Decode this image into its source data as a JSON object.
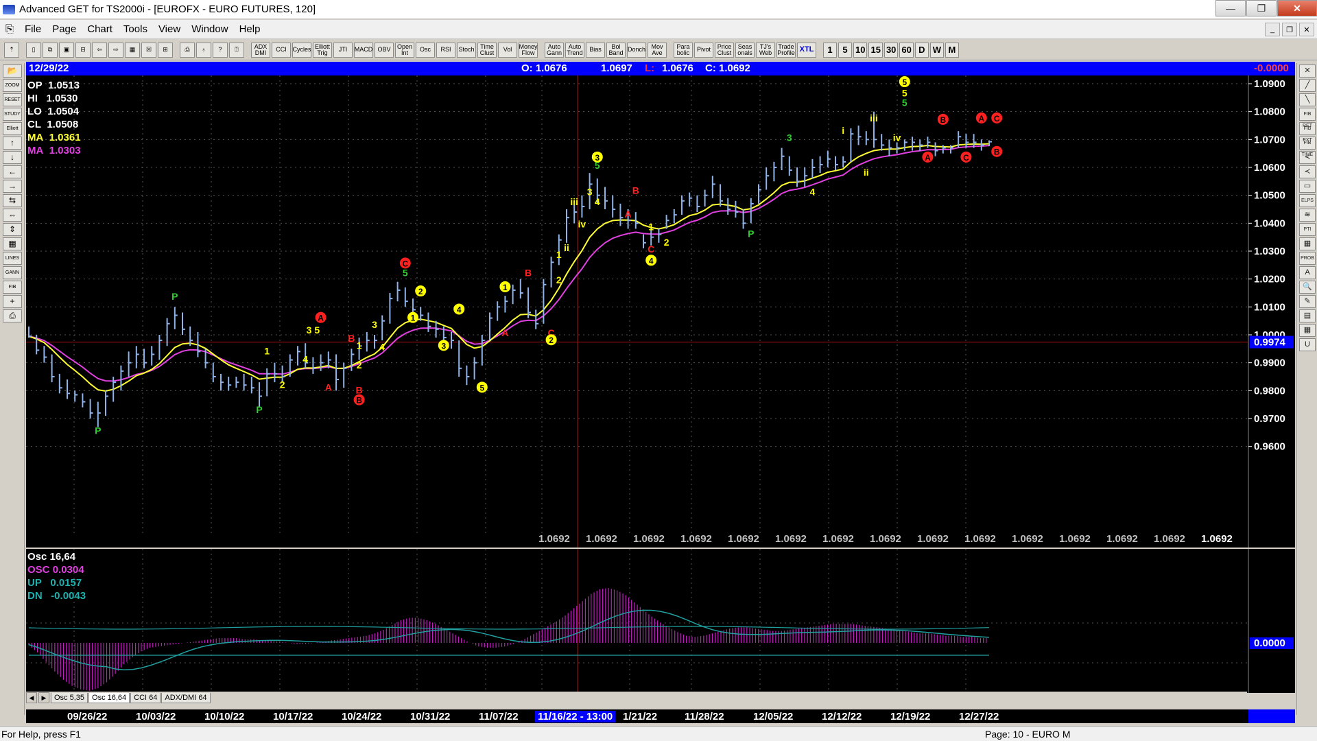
{
  "window": {
    "title": "Advanced GET for TS2000i - [EUROFX - EURO FUTURES, 120]",
    "minimize": "—",
    "restore": "❐",
    "close": "✕"
  },
  "menu": [
    "File",
    "Page",
    "Chart",
    "Tools",
    "View",
    "Window",
    "Help"
  ],
  "mdi_buttons": [
    "_",
    "❐",
    "✕"
  ],
  "toolbar": {
    "studies": [
      "ADX DMI",
      "CCI",
      "Cycles",
      "Elliott Trig",
      "JTI",
      "MACD",
      "OBV",
      "Open Int",
      "Osc",
      "RSI",
      "Stoch",
      "Time Clust",
      "Vol",
      "Money Flow",
      "Auto Gann",
      "Auto Trend",
      "Bias",
      "Bol Band",
      "Donch",
      "Mov Ave",
      "Para bolic",
      "Pivot",
      "Price Clust",
      "Seas onals",
      "TJ's Web",
      "Trade Profile",
      "XTL"
    ],
    "timeframes": [
      "1",
      "5",
      "10",
      "15",
      "30",
      "60",
      "D",
      "W",
      "M"
    ]
  },
  "left_tools": [
    "📂",
    "ZOOM",
    "RESET",
    "STUDY",
    "Elliott",
    "↑",
    "↓",
    "←",
    "→",
    "⇆",
    "⇔",
    "⇕",
    "▦",
    "LINES",
    "GANN",
    "FIB",
    "+",
    "⎙"
  ],
  "right_tools": [
    "✕",
    "╱",
    "╲",
    "FIB RET",
    "FIB EXT",
    "FIB TIME",
    "≺",
    "≺",
    "▭",
    "ELPS",
    "≋",
    "PTI",
    "▦",
    "PROB",
    "A",
    "🔍",
    "✎",
    "▤",
    "▦",
    "U"
  ],
  "price_header": {
    "date": "12/29/22",
    "open": "O: 1.0676",
    "high": "1.0697",
    "low_label": "L:",
    "low": "1.0676",
    "close": "C: 1.0692",
    "change": "-0.0000"
  },
  "stats": {
    "op_label": "OP",
    "op": "1.0513",
    "hi_label": "HI",
    "hi": "1.0530",
    "lo_label": "LO",
    "lo": "1.0504",
    "cl_label": "CL",
    "cl": "1.0508",
    "ma1_label": "MA",
    "ma1": "1.0361",
    "ma2_label": "MA",
    "ma2": "1.0303"
  },
  "osc_stats": {
    "title": "Osc 16,64",
    "osc_label": "OSC",
    "osc": "0.0304",
    "up_label": "UP",
    "up": "0.0157",
    "dn_label": "DN",
    "dn": "-0.0043",
    "zero_label": "0.0000"
  },
  "price_axis": [
    "1.0900",
    "1.0800",
    "1.0700",
    "1.0600",
    "1.0500",
    "1.0400",
    "1.0300",
    "1.0200",
    "1.0100",
    "1.0000",
    "0.9900",
    "0.9800",
    "0.9700",
    "0.9600"
  ],
  "current_price_label": "0.9974",
  "projection_labels": [
    "1.0692",
    "1.0692",
    "1.0692",
    "1.0692",
    "1.0692",
    "1.0692",
    "1.0692",
    "1.0692",
    "1.0692",
    "1.0692",
    "1.0692",
    "1.0692",
    "1.0692",
    "1.0692",
    "1.0692"
  ],
  "dates": [
    "09/26/22",
    "10/03/22",
    "10/10/22",
    "10/17/22",
    "10/24/22",
    "10/31/22",
    "11/07/22",
    "11/16/22 - 13:00",
    "1/21/22",
    "11/28/22",
    "12/05/22",
    "12/12/22",
    "12/19/22",
    "12/27/22"
  ],
  "selected_date_index": 7,
  "tabs": [
    "Osc 5,35",
    "Osc 16,64",
    "CCI 64",
    "ADX/DMI 64"
  ],
  "active_tab": 1,
  "tab_arrows": [
    "◀",
    "▶"
  ],
  "status": {
    "help": "For Help, press F1",
    "page": "Page: 10 - EURO M"
  },
  "colors": {
    "price_bar": "#8fb2e8",
    "ma_fast": "#ffff33",
    "ma_slow": "#e040e0",
    "header_blue": "#0000ff",
    "wave_yellow": "#ffff00",
    "wave_red": "#ff2020",
    "wave_green": "#33cc33",
    "osc_hist": "#c020c0",
    "osc_band": "#20a0a0"
  },
  "chart_data": {
    "type": "bar",
    "series_name": "",
    "ylim": [
      0.955,
      1.092
    ],
    "bars": [
      [
        1.003,
        0.999,
        0.9995
      ],
      [
        1.0,
        0.993,
        0.9945
      ],
      [
        0.996,
        0.99,
        0.992
      ],
      [
        0.993,
        0.983,
        0.985
      ],
      [
        0.986,
        0.979,
        0.981
      ],
      [
        0.984,
        0.977,
        0.979
      ],
      [
        0.98,
        0.976,
        0.9785
      ],
      [
        0.979,
        0.974,
        0.976
      ],
      [
        0.977,
        0.97,
        0.972
      ],
      [
        0.976,
        0.967,
        0.972
      ],
      [
        0.98,
        0.971,
        0.978
      ],
      [
        0.985,
        0.976,
        0.983
      ],
      [
        0.989,
        0.98,
        0.987
      ],
      [
        0.994,
        0.985,
        0.99
      ],
      [
        0.996,
        0.988,
        0.993
      ],
      [
        0.995,
        0.988,
        0.99
      ],
      [
        0.996,
        0.989,
        0.993
      ],
      [
        1.0,
        0.991,
        0.998
      ],
      [
        1.006,
        0.996,
        1.004
      ],
      [
        1.01,
        1.002,
        1.007
      ],
      [
        1.008,
        1.0,
        1.002
      ],
      [
        1.003,
        0.996,
        0.998
      ],
      [
        1.001,
        0.992,
        0.994
      ],
      [
        0.995,
        0.988,
        0.99
      ],
      [
        0.99,
        0.983,
        0.985
      ],
      [
        0.986,
        0.98,
        0.983
      ],
      [
        0.985,
        0.98,
        0.982
      ],
      [
        0.985,
        0.981,
        0.983
      ],
      [
        0.986,
        0.98,
        0.982
      ],
      [
        0.985,
        0.979,
        0.981
      ],
      [
        0.983,
        0.974,
        0.978
      ],
      [
        0.988,
        0.978,
        0.986
      ],
      [
        0.99,
        0.983,
        0.986
      ],
      [
        0.989,
        0.983,
        0.985
      ],
      [
        0.993,
        0.985,
        0.991
      ],
      [
        0.996,
        0.989,
        0.994
      ],
      [
        0.997,
        0.988,
        0.99
      ],
      [
        0.992,
        0.986,
        0.988
      ],
      [
        0.993,
        0.987,
        0.99
      ],
      [
        0.994,
        0.988,
        0.991
      ],
      [
        0.993,
        0.98,
        0.984
      ],
      [
        0.99,
        0.981,
        0.988
      ],
      [
        0.995,
        0.987,
        0.993
      ],
      [
        0.999,
        0.991,
        0.996
      ],
      [
        1.001,
        0.994,
        0.998
      ],
      [
        1.0,
        0.995,
        0.998
      ],
      [
        1.007,
        0.998,
        1.005
      ],
      [
        1.015,
        1.004,
        1.013
      ],
      [
        1.019,
        1.012,
        1.016
      ],
      [
        1.017,
        1.01,
        1.012
      ],
      [
        1.013,
        1.006,
        1.009
      ],
      [
        1.01,
        1.005,
        1.007
      ],
      [
        1.008,
        1.001,
        1.003
      ],
      [
        1.005,
        0.999,
        1.002
      ],
      [
        1.003,
        0.996,
        0.999
      ],
      [
        1.001,
        0.995,
        0.998
      ],
      [
        0.998,
        0.985,
        0.988
      ],
      [
        0.989,
        0.982,
        0.985
      ],
      [
        0.992,
        0.984,
        0.99
      ],
      [
        1.0,
        0.989,
        0.998
      ],
      [
        1.008,
        0.998,
        1.006
      ],
      [
        1.012,
        1.005,
        1.01
      ],
      [
        1.014,
        1.008,
        1.012
      ],
      [
        1.018,
        1.011,
        1.016
      ],
      [
        1.02,
        1.013,
        1.015
      ],
      [
        1.017,
        1.006,
        1.008
      ],
      [
        1.009,
        1.002,
        1.004
      ],
      [
        1.02,
        1.004,
        1.018
      ],
      [
        1.028,
        1.017,
        1.026
      ],
      [
        1.036,
        1.025,
        1.034
      ],
      [
        1.045,
        1.033,
        1.042
      ],
      [
        1.048,
        1.04,
        1.044
      ],
      [
        1.05,
        1.042,
        1.046
      ],
      [
        1.058,
        1.045,
        1.054
      ],
      [
        1.056,
        1.047,
        1.05
      ],
      [
        1.053,
        1.045,
        1.048
      ],
      [
        1.05,
        1.042,
        1.045
      ],
      [
        1.047,
        1.039,
        1.042
      ],
      [
        1.045,
        1.038,
        1.041
      ],
      [
        1.044,
        1.038,
        1.04
      ],
      [
        1.036,
        1.031,
        1.033
      ],
      [
        1.038,
        1.032,
        1.035
      ],
      [
        1.038,
        1.033,
        1.036
      ],
      [
        1.043,
        1.038,
        1.041
      ],
      [
        1.045,
        1.04,
        1.043
      ],
      [
        1.05,
        1.043,
        1.048
      ],
      [
        1.051,
        1.046,
        1.049
      ],
      [
        1.05,
        1.044,
        1.046
      ],
      [
        1.052,
        1.046,
        1.05
      ],
      [
        1.057,
        1.049,
        1.054
      ],
      [
        1.054,
        1.046,
        1.048
      ],
      [
        1.049,
        1.043,
        1.045
      ],
      [
        1.048,
        1.042,
        1.044
      ],
      [
        1.045,
        1.038,
        1.04
      ],
      [
        1.049,
        1.04,
        1.047
      ],
      [
        1.054,
        1.047,
        1.052
      ],
      [
        1.06,
        1.052,
        1.057
      ],
      [
        1.062,
        1.055,
        1.06
      ],
      [
        1.067,
        1.059,
        1.064
      ],
      [
        1.064,
        1.057,
        1.059
      ],
      [
        1.06,
        1.053,
        1.055
      ],
      [
        1.06,
        1.053,
        1.057
      ],
      [
        1.063,
        1.056,
        1.06
      ],
      [
        1.064,
        1.058,
        1.061
      ],
      [
        1.066,
        1.06,
        1.063
      ],
      [
        1.064,
        1.059,
        1.061
      ],
      [
        1.064,
        1.06,
        1.062
      ],
      [
        1.074,
        1.062,
        1.072
      ],
      [
        1.075,
        1.068,
        1.071
      ],
      [
        1.073,
        1.068,
        1.07
      ],
      [
        1.08,
        1.067,
        1.07
      ],
      [
        1.072,
        1.066,
        1.068
      ],
      [
        1.07,
        1.064,
        1.067
      ],
      [
        1.069,
        1.065,
        1.067
      ],
      [
        1.07,
        1.066,
        1.069
      ],
      [
        1.071,
        1.066,
        1.069
      ],
      [
        1.07,
        1.066,
        1.068
      ],
      [
        1.071,
        1.067,
        1.069
      ],
      [
        1.069,
        1.064,
        1.066
      ],
      [
        1.068,
        1.065,
        1.067
      ],
      [
        1.068,
        1.065,
        1.067
      ],
      [
        1.073,
        1.067,
        1.071
      ],
      [
        1.072,
        1.067,
        1.069
      ],
      [
        1.072,
        1.067,
        1.069
      ],
      [
        1.07,
        1.066,
        1.068
      ],
      [
        1.0697,
        1.0676,
        1.0692
      ]
    ],
    "osc_ylim": [
      -0.05,
      0.05
    ],
    "osc_values": [
      -0.002,
      -0.008,
      -0.016,
      -0.024,
      -0.031,
      -0.036,
      -0.039,
      -0.04,
      -0.038,
      -0.033,
      -0.026,
      -0.018,
      -0.012,
      -0.007,
      -0.004,
      -0.003,
      -0.002,
      -0.001,
      0.0,
      0.001,
      0.002,
      0.003,
      0.004,
      0.004,
      0.004,
      0.003,
      0.003,
      0.002,
      0.002,
      0.001,
      0.0,
      -0.001,
      -0.001,
      0.0,
      0.001,
      0.002,
      0.003,
      0.004,
      0.005,
      0.006,
      0.008,
      0.011,
      0.015,
      0.019,
      0.021,
      0.021,
      0.019,
      0.016,
      0.012,
      0.008,
      0.004,
      0.0,
      -0.003,
      -0.004,
      -0.004,
      -0.003,
      -0.001,
      0.002,
      0.006,
      0.01,
      0.014,
      0.018,
      0.023,
      0.029,
      0.035,
      0.041,
      0.045,
      0.046,
      0.044,
      0.04,
      0.034,
      0.028,
      0.022,
      0.017,
      0.013,
      0.009,
      0.006,
      0.005,
      0.006,
      0.008,
      0.01,
      0.012,
      0.013,
      0.013,
      0.012,
      0.011,
      0.01,
      0.01,
      0.011,
      0.012,
      0.013,
      0.014,
      0.015,
      0.016,
      0.016,
      0.016,
      0.015,
      0.014,
      0.013,
      0.012,
      0.011,
      0.01,
      0.009,
      0.008,
      0.008,
      0.007,
      0.006,
      0.006,
      0.005,
      0.005,
      0.004,
      0.004
    ],
    "labels": [
      {
        "t": "P",
        "i": 9,
        "p": 0.9645,
        "c": "wave_green"
      },
      {
        "t": "P",
        "i": 19,
        "p": 1.0125,
        "c": "wave_green"
      },
      {
        "t": "P",
        "i": 30,
        "p": 0.972,
        "c": "wave_green"
      },
      {
        "t": "P",
        "i": 94,
        "p": 1.035,
        "c": "wave_green"
      },
      {
        "t": "1",
        "i": 31,
        "p": 0.993,
        "c": "wave_yellow"
      },
      {
        "t": "2",
        "i": 33,
        "p": 0.981,
        "c": "wave_yellow"
      },
      {
        "t": "3 5",
        "i": 37,
        "p": 1.0005,
        "c": "wave_yellow"
      },
      {
        "t": "4",
        "i": 36,
        "p": 0.99,
        "c": "wave_yellow"
      },
      {
        "t": "A",
        "i": 38,
        "p": 1.005,
        "c": "wave_red",
        "circ": true
      },
      {
        "t": "A",
        "i": 39,
        "p": 0.98,
        "c": "wave_red"
      },
      {
        "t": "B",
        "i": 42,
        "p": 0.9975,
        "c": "wave_red"
      },
      {
        "t": "1",
        "i": 43,
        "p": 0.995,
        "c": "wave_yellow"
      },
      {
        "t": "2",
        "i": 43,
        "p": 0.988,
        "c": "wave_yellow"
      },
      {
        "t": "B",
        "i": 43,
        "p": 0.979,
        "c": "wave_red"
      },
      {
        "t": "B",
        "i": 43,
        "p": 0.9755,
        "c": "wave_red",
        "circ": true
      },
      {
        "t": "3",
        "i": 45,
        "p": 1.0025,
        "c": "wave_yellow"
      },
      {
        "t": "4",
        "i": 46,
        "p": 0.9945,
        "c": "wave_yellow"
      },
      {
        "t": "C",
        "i": 49,
        "p": 1.0245,
        "c": "wave_red",
        "circ": true
      },
      {
        "t": "5",
        "i": 49,
        "p": 1.021,
        "c": "wave_green"
      },
      {
        "t": "2",
        "i": 51,
        "p": 1.0145,
        "c": "wave_yellow",
        "circ": true
      },
      {
        "t": "1",
        "i": 50,
        "p": 1.005,
        "c": "wave_yellow",
        "circ": true
      },
      {
        "t": "4",
        "i": 56,
        "p": 1.008,
        "c": "wave_yellow",
        "circ": true
      },
      {
        "t": "3",
        "i": 54,
        "p": 0.995,
        "c": "wave_yellow",
        "circ": true
      },
      {
        "t": "5",
        "i": 59,
        "p": 0.98,
        "c": "wave_yellow",
        "circ": true
      },
      {
        "t": "A",
        "i": 62,
        "p": 0.9995,
        "c": "wave_red"
      },
      {
        "t": "1",
        "i": 62,
        "p": 1.016,
        "c": "wave_yellow",
        "circ": true
      },
      {
        "t": "B",
        "i": 65,
        "p": 1.021,
        "c": "wave_red"
      },
      {
        "t": "C",
        "i": 68,
        "p": 0.9995,
        "c": "wave_red"
      },
      {
        "t": "2",
        "i": 68,
        "p": 0.997,
        "c": "wave_yellow",
        "circ": true
      },
      {
        "t": "1",
        "i": 69,
        "p": 1.0275,
        "c": "wave_yellow"
      },
      {
        "t": "ii",
        "i": 70,
        "p": 1.03,
        "c": "wave_yellow"
      },
      {
        "t": "2",
        "i": 69,
        "p": 1.0185,
        "c": "wave_yellow"
      },
      {
        "t": "iii",
        "i": 71,
        "p": 1.0465,
        "c": "wave_yellow"
      },
      {
        "t": "iv",
        "i": 72,
        "p": 1.0385,
        "c": "wave_yellow"
      },
      {
        "t": "3",
        "i": 74,
        "p": 1.0625,
        "c": "wave_yellow",
        "circ": true
      },
      {
        "t": "5",
        "i": 74,
        "p": 1.0595,
        "c": "wave_green"
      },
      {
        "t": "3",
        "i": 73,
        "p": 1.05,
        "c": "wave_yellow"
      },
      {
        "t": "4",
        "i": 74,
        "p": 1.0465,
        "c": "wave_yellow"
      },
      {
        "t": "B",
        "i": 79,
        "p": 1.0505,
        "c": "wave_red"
      },
      {
        "t": "A",
        "i": 78,
        "p": 1.042,
        "c": "wave_red"
      },
      {
        "t": "1",
        "i": 81,
        "p": 1.0375,
        "c": "wave_yellow"
      },
      {
        "t": "2",
        "i": 83,
        "p": 1.032,
        "c": "wave_yellow"
      },
      {
        "t": "C",
        "i": 81,
        "p": 1.0295,
        "c": "wave_red"
      },
      {
        "t": "4",
        "i": 81,
        "p": 1.0255,
        "c": "wave_yellow",
        "circ": true
      },
      {
        "t": "3",
        "i": 99,
        "p": 1.0695,
        "c": "wave_green"
      },
      {
        "t": "i",
        "i": 106,
        "p": 1.072,
        "c": "wave_yellow"
      },
      {
        "t": "4",
        "i": 102,
        "p": 1.05,
        "c": "wave_yellow"
      },
      {
        "t": "ii",
        "i": 109,
        "p": 1.057,
        "c": "wave_yellow"
      },
      {
        "t": "iii",
        "i": 110,
        "p": 1.0765,
        "c": "wave_yellow"
      },
      {
        "t": "iv",
        "i": 113,
        "p": 1.0695,
        "c": "wave_yellow"
      },
      {
        "t": "5",
        "i": 114,
        "p": 1.0895,
        "c": "wave_yellow",
        "circ": true
      },
      {
        "t": "5",
        "i": 114,
        "p": 1.0855,
        "c": "wave_yellow"
      },
      {
        "t": "5",
        "i": 114,
        "p": 1.082,
        "c": "wave_green"
      },
      {
        "t": "A",
        "i": 117,
        "p": 1.0625,
        "c": "wave_red",
        "circ": true
      },
      {
        "t": "B",
        "i": 119,
        "p": 1.076,
        "c": "wave_red",
        "circ": true
      },
      {
        "t": "C",
        "i": 122,
        "p": 1.0625,
        "c": "wave_red",
        "circ": true
      },
      {
        "t": "A",
        "i": 124,
        "p": 1.0765,
        "c": "wave_red",
        "circ": true
      },
      {
        "t": "C",
        "i": 126,
        "p": 1.0765,
        "c": "wave_red",
        "circ": true
      },
      {
        "t": "B",
        "i": 126,
        "p": 1.0645,
        "c": "wave_red",
        "circ": true
      }
    ]
  }
}
